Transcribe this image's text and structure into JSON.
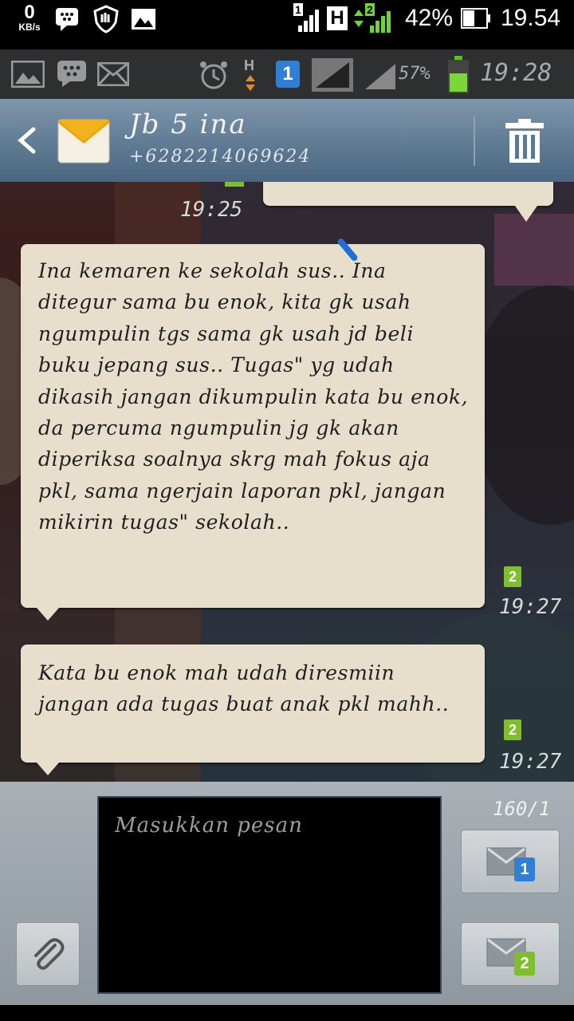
{
  "status_bar": {
    "speed_value": "0",
    "speed_unit": "KB/s",
    "battery_percent": "42%",
    "time": "19.54",
    "sim1_label": "1",
    "sim2_label": "2",
    "network_type": "H"
  },
  "inner_status_bar": {
    "network_type": "H",
    "sim_label": "1",
    "battery_percent": "57%",
    "time": "19:28"
  },
  "header": {
    "contact_name": "Jb 5 ina",
    "phone_number": "+6282214069624"
  },
  "messages": [
    {
      "time": "19:25"
    },
    {
      "text": "Ina kemaren ke sekolah sus.. Ina ditegur sama bu enok, kita gk usah ngumpulin tgs sama gk usah jd beli buku jepang sus.. Tugas\" yg udah dikasih jangan dikumpulin kata bu enok, da percuma ngumpulin jg gk akan diperiksa soalnya skrg mah fokus aja pkl, sama ngerjain laporan pkl, jangan mikirin tugas\" sekolah..",
      "sim": "2",
      "time": "19:27"
    },
    {
      "text": "Kata bu enok mah udah diresmiin jangan ada tugas buat anak pkl mahh..",
      "sim": "2",
      "time": "19:27"
    }
  ],
  "compose": {
    "placeholder": "Masukkan pesan",
    "char_counter": "160/1",
    "send_sim1_badge": "1",
    "send_sim2_badge": "2"
  }
}
